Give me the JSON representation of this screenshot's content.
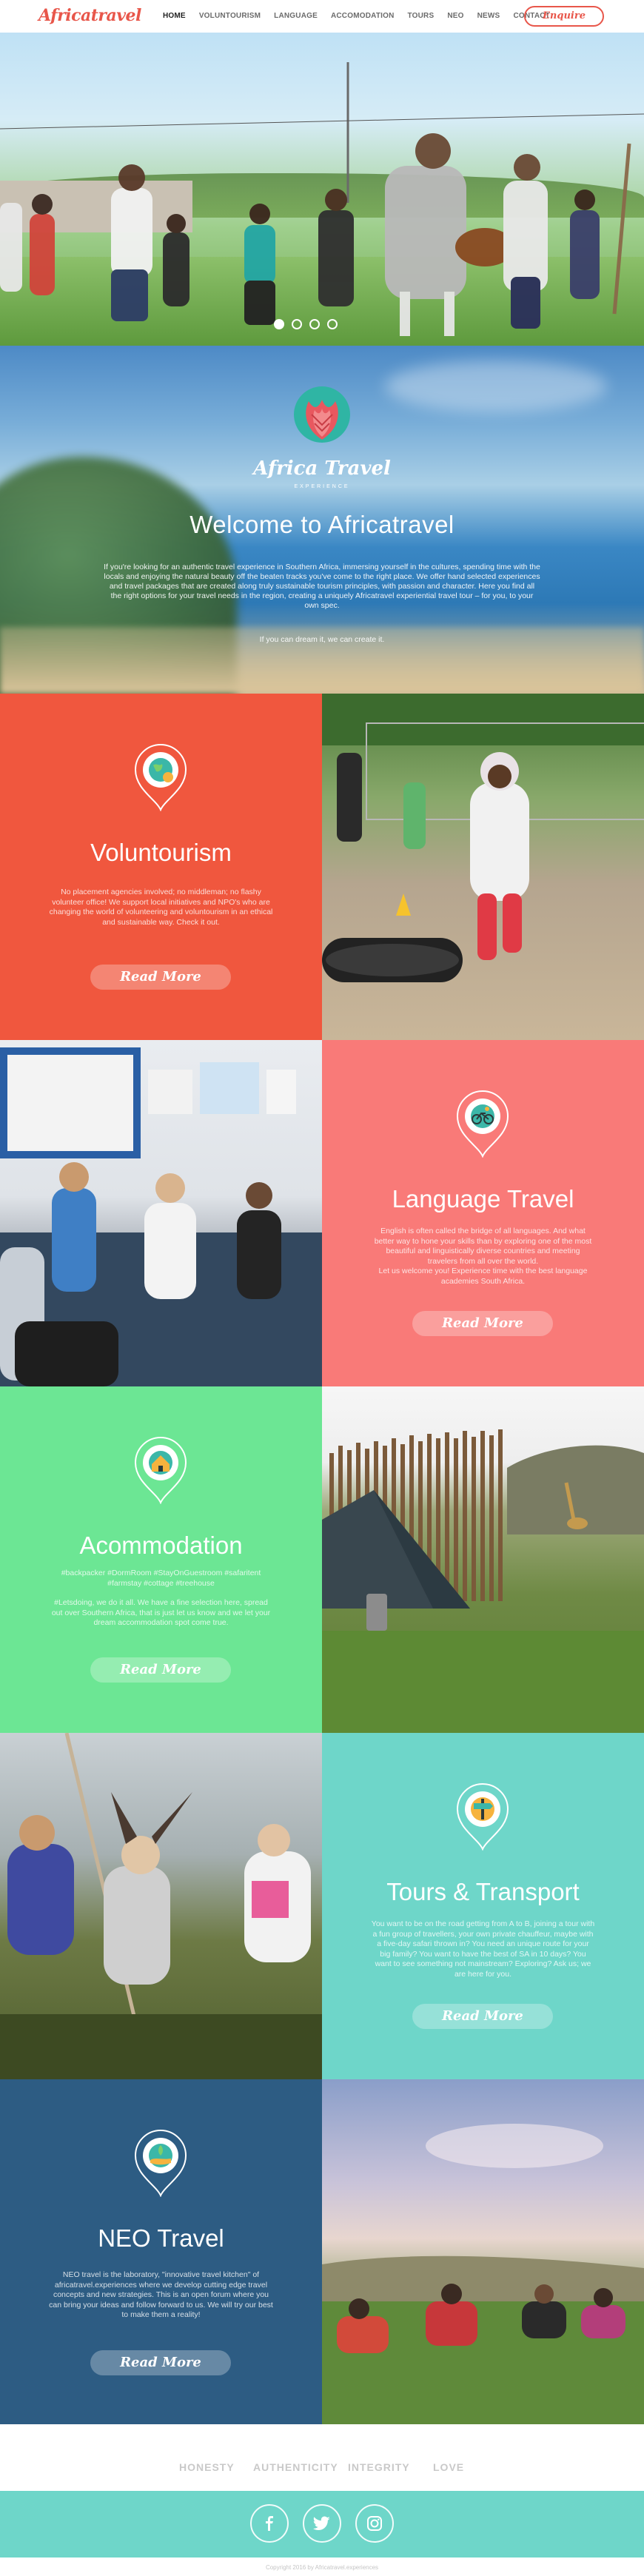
{
  "nav": {
    "logo": "Africatravel",
    "items": [
      "HOME",
      "VOLUNTOURISM",
      "LANGUAGE",
      "ACCOMODATION",
      "TOURS",
      "NEO",
      "NEWS",
      "CONTACT"
    ],
    "active": "HOME",
    "enquire_label": "Enquire",
    "accent_color": "#e8564a"
  },
  "hero": {
    "slides": 4,
    "active_slide": 1
  },
  "welcome": {
    "brand_name": "Africa Travel",
    "brand_sub": "EXPERIENCE",
    "title": "Welcome to Africatravel",
    "text": "If you're looking for an authentic travel experience in Southern Africa, immersing yourself in the cultures, spending time with the locals and enjoying the natural beauty off the beaten tracks you've come to the right place. We offer hand selected experiences and travel packages that are created along truly sustainable tourism principles, with passion and character. Here you find all the right options for your travel needs in the region, creating a uniquely Africatravel experiential travel tour – for you, to your own spec.",
    "text2": "If you can dream it, we can create it."
  },
  "panels": {
    "voluntourism": {
      "title": "Voluntourism",
      "text": "No placement agencies involved; no middleman; no flashy volunteer office! We support local initiatives and NPO's who are changing the world of volunteering and voluntourism in an ethical and sustainable way. Check it out.",
      "button": "Read More",
      "icon": "globe-icon"
    },
    "language": {
      "title": "Language Travel",
      "text": "English is often called the bridge of all languages. And what better way to hone your skills than by exploring one of the most beautiful and linguistically diverse countries and meeting travelers from all over the world.",
      "text2": "Let us welcome you! Experience time with the best language academies South Africa.",
      "button": "Read More",
      "icon": "bicycle-icon"
    },
    "accommodation": {
      "title": "Acommodation",
      "text": "#backpacker #DormRoom #StayOnGuestroom #safaritent #farmstay #cottage #treehouse",
      "text2": "#Letsdoing, we do it all. We have a fine selection here, spread out over Southern Africa, that is just let us know and we let your dream accommodation spot come true.",
      "button": "Read More",
      "icon": "house-icon"
    },
    "tours": {
      "title": "Tours & Transport",
      "text": "You want to be on the road getting from A to B, joining a tour with a fun group of travellers, your own private chauffeur, maybe with a five-day safari thrown in? You need an unique route for your big family? You want to have the best of SA in 10 days? You want to see something not mainstream? Exploring? Ask us; we are here for you.",
      "button": "Read More",
      "icon": "signpost-icon"
    },
    "neo": {
      "title": "NEO Travel",
      "text": "NEO travel is the laboratory, \"innovative travel kitchen\" of africatravel.experiences where we develop cutting edge travel concepts and new strategies. This is an open forum where you can bring your ideas and follow forward to us. We will try our best to make them a reality!",
      "button": "Read More",
      "icon": "hand-plant-icon"
    }
  },
  "values": [
    "HONESTY",
    "AUTHENTICITY",
    "INTEGRITY",
    "LOVE"
  ],
  "social": [
    "facebook-icon",
    "twitter-icon",
    "instagram-icon"
  ],
  "footer": {
    "copyright": "Copyright 2016 by Africatravel.experiences"
  },
  "colors": {
    "red": "#f0573e",
    "pink": "#f97a78",
    "green": "#6ce694",
    "teal": "#6ed6c9",
    "navy": "#2d5c83"
  }
}
